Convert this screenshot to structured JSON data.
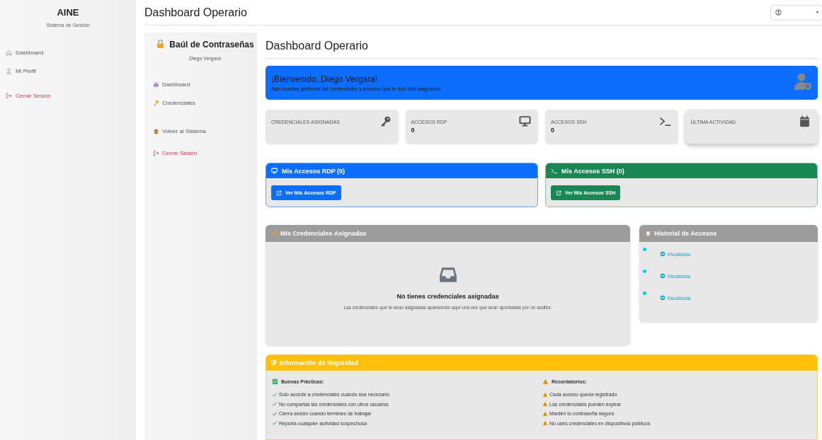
{
  "app": {
    "name": "AINE",
    "subtitle": "Sistema de Gestión"
  },
  "sidebar": {
    "items": [
      {
        "label": "Dashboard",
        "kind": "home"
      },
      {
        "label": "Mi Perfil",
        "kind": "user"
      },
      {
        "label": "Cerrar Sesión",
        "kind": "logout"
      }
    ]
  },
  "header": {
    "title": "Dashboard Operario"
  },
  "vault_sidebar": {
    "title": "Baúl de Contraseñas",
    "user": "Diego Vergara",
    "items": [
      {
        "label": "Dashboard",
        "kind": "chart"
      },
      {
        "label": "Credenciales",
        "kind": "key"
      },
      {
        "label": "Volver al Sistema",
        "kind": "house"
      },
      {
        "label": "Cerrar Sesión",
        "kind": "logout"
      }
    ]
  },
  "page": {
    "title": "Dashboard Operario"
  },
  "welcome": {
    "title": "¡Bienvenido, Diego Vergara!",
    "message": "Aquí puedes gestionar las credenciales y accesos que te han sido asignados."
  },
  "stats": [
    {
      "label": "CREDENCIALES ASIGNADAS",
      "kind": "key"
    },
    {
      "label": "ACCESOS RDP",
      "value": "0",
      "kind": "monitor"
    },
    {
      "label": "ACCESOS SSH",
      "value": "0",
      "kind": "terminal"
    },
    {
      "label": "ÚLTIMA ACTIVIDAD",
      "kind": "calendar"
    }
  ],
  "access_panels": [
    {
      "title": "Mis Accesos RDP (0)",
      "button": "Ver Mis Accesos RDP",
      "kind": "rdp"
    },
    {
      "title": "Mis Accesos SSH (0)",
      "button": "Ver Mis Accesos SSH",
      "kind": "ssh"
    }
  ],
  "credentials": {
    "title": "Mis Credenciales Asignadas",
    "empty_title": "No tienes credenciales asignadas",
    "empty_message": "Las credenciales que te sean asignadas aparecerán aquí una vez que sean aprobadas por un auditor."
  },
  "history": {
    "title": "Historial de Accesos",
    "items": [
      {
        "status": "Visualizada"
      },
      {
        "status": "Visualizada"
      },
      {
        "status": "Visualizada"
      }
    ]
  },
  "security": {
    "title": "Información de Seguridad",
    "practices": {
      "title": "Buenas Prácticas:",
      "items": [
        "Solo accede a credenciales cuando sea necesario",
        "No compartas las credenciales con otros usuarios",
        "Cierra sesión cuando termines de trabajar",
        "Reporta cualquier actividad sospechosa"
      ]
    },
    "reminders": {
      "title": "Recordatorios:",
      "items": [
        "Cada acceso queda registrado",
        "Las credenciales pueden expirar",
        "Mantén tu contraseña segura",
        "No uses credenciales en dispositivos públicos"
      ]
    }
  }
}
